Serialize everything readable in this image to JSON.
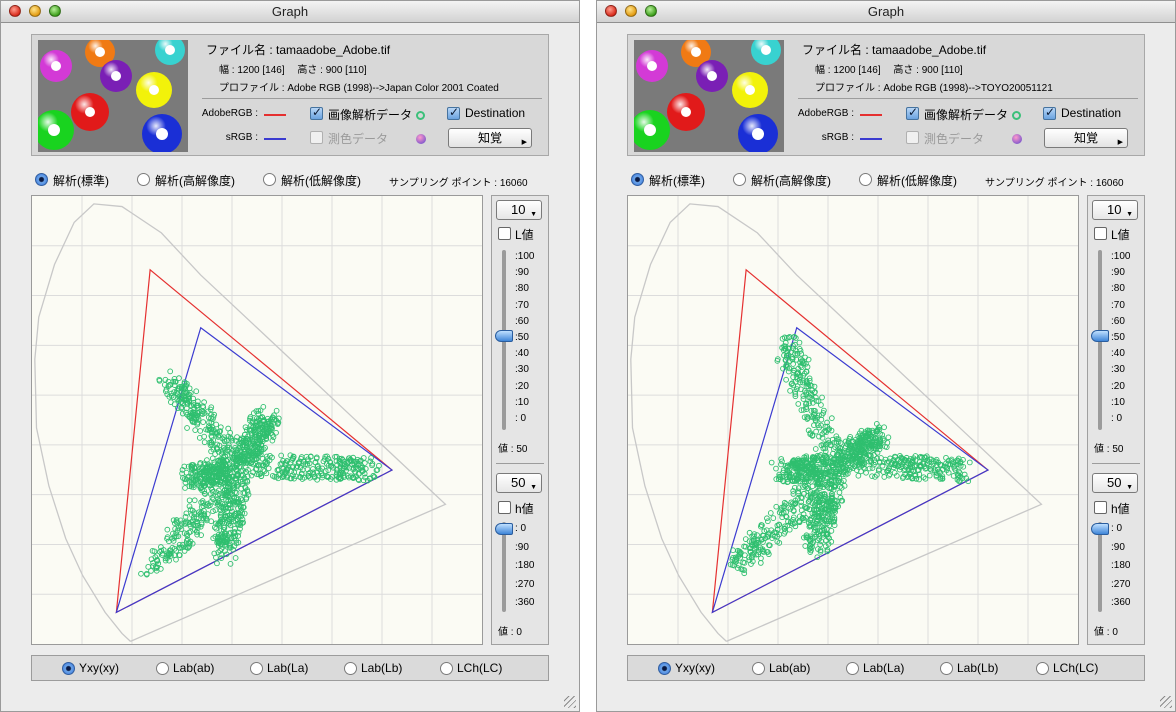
{
  "colors": {
    "adobe_rgb_line": "#e53030",
    "srgb_line": "#3b3bd0",
    "analysis_points": "#2fbf6f",
    "locus": "#c8c8c8",
    "plot_background": "#fbfbf4",
    "grid": "#dcdcdc"
  },
  "windows": [
    {
      "title": "Graph",
      "file_name": "ファイル名 : tamaadobe_Adobe.tif",
      "dimensions": "幅 : 1200 [146]　 高さ : 900 [110]",
      "profile": "プロファイル : Adobe RGB (1998)-->Japan Color 2001 Coated",
      "legend": {
        "adobe_rgb": "AdobeRGB :",
        "srgb": "sRGB :"
      },
      "image_analysis": {
        "label": "画像解析データ",
        "checked": true
      },
      "measurement": {
        "label": "測色データ",
        "checked": false
      },
      "destination": {
        "label": "Destination",
        "checked": true
      },
      "intent": "知覚",
      "modes": [
        "解析(標準)",
        "解析(高解像度)",
        "解析(低解像度)"
      ],
      "selected_mode": 0,
      "sampling": "サンプリング ポイント : 16060",
      "l_step": "10",
      "l_toggle": "L値",
      "l_ticks": [
        ":100",
        ":90",
        ":80",
        ":70",
        ":60",
        ":50",
        ":40",
        ":30",
        ":20",
        ":10",
        ": 0"
      ],
      "l_value": "値 : 50",
      "l_level": 50,
      "h_step": "50",
      "h_toggle": "h値",
      "h_ticks": [
        ": 0",
        ":90",
        ":180",
        ":270",
        ":360"
      ],
      "h_value": "値 : 0",
      "h_level": 0,
      "views": [
        "Yxy(xy)",
        "Lab(ab)",
        "Lab(La)",
        "Lab(Lb)",
        "LCh(LC)"
      ],
      "selected_view": 0,
      "destination_gamut": "Japan Color 2001 Coated"
    },
    {
      "title": "Graph",
      "file_name": "ファイル名 : tamaadobe_Adobe.tif",
      "dimensions": "幅 : 1200 [146]　 高さ : 900 [110]",
      "profile": "プロファイル : Adobe RGB (1998)-->TOYO20051121",
      "legend": {
        "adobe_rgb": "AdobeRGB :",
        "srgb": "sRGB :"
      },
      "image_analysis": {
        "label": "画像解析データ",
        "checked": true
      },
      "measurement": {
        "label": "測色データ",
        "checked": false
      },
      "destination": {
        "label": "Destination",
        "checked": true
      },
      "intent": "知覚",
      "modes": [
        "解析(標準)",
        "解析(高解像度)",
        "解析(低解像度)"
      ],
      "selected_mode": 0,
      "sampling": "サンプリング ポイント : 16060",
      "l_step": "10",
      "l_toggle": "L値",
      "l_ticks": [
        ":100",
        ":90",
        ":80",
        ":70",
        ":60",
        ":50",
        ":40",
        ":30",
        ":20",
        ":10",
        ": 0"
      ],
      "l_value": "値 : 50",
      "l_level": 50,
      "h_step": "50",
      "h_toggle": "h値",
      "h_ticks": [
        ": 0",
        ":90",
        ":180",
        ":270",
        ":360"
      ],
      "h_value": "値 : 0",
      "h_level": 0,
      "views": [
        "Yxy(xy)",
        "Lab(ab)",
        "Lab(La)",
        "Lab(Lb)",
        "LCh(LC)"
      ],
      "selected_view": 0,
      "destination_gamut": "TOYO20051121"
    }
  ],
  "chart_data": [
    {
      "type": "scatter",
      "title": "",
      "xlabel": "",
      "ylabel": "",
      "xlim": [
        0,
        0.8
      ],
      "ylim": [
        0,
        0.85
      ],
      "grid": true,
      "series": [
        {
          "name": "AdobeRGB",
          "kind": "triangle",
          "points": [
            [
              0.64,
              0.33
            ],
            [
              0.21,
              0.71
            ],
            [
              0.15,
              0.06
            ]
          ]
        },
        {
          "name": "sRGB",
          "kind": "triangle",
          "points": [
            [
              0.64,
              0.33
            ],
            [
              0.3,
              0.6
            ],
            [
              0.15,
              0.06
            ]
          ]
        },
        {
          "name": "画像解析データ",
          "kind": "scatter_cluster",
          "approx_extent": {
            "x": [
              0.19,
              0.62
            ],
            "y": [
              0.1,
              0.55
            ]
          }
        }
      ]
    },
    {
      "type": "scatter",
      "title": "",
      "xlabel": "",
      "ylabel": "",
      "xlim": [
        0,
        0.8
      ],
      "ylim": [
        0,
        0.85
      ],
      "grid": true,
      "series": [
        {
          "name": "AdobeRGB",
          "kind": "triangle",
          "points": [
            [
              0.64,
              0.33
            ],
            [
              0.21,
              0.71
            ],
            [
              0.15,
              0.06
            ]
          ]
        },
        {
          "name": "sRGB",
          "kind": "triangle",
          "points": [
            [
              0.64,
              0.33
            ],
            [
              0.3,
              0.6
            ],
            [
              0.15,
              0.06
            ]
          ]
        },
        {
          "name": "画像解析データ",
          "kind": "scatter_cluster",
          "approx_extent": {
            "x": [
              0.17,
              0.62
            ],
            "y": [
              0.12,
              0.62
            ]
          }
        }
      ]
    }
  ]
}
